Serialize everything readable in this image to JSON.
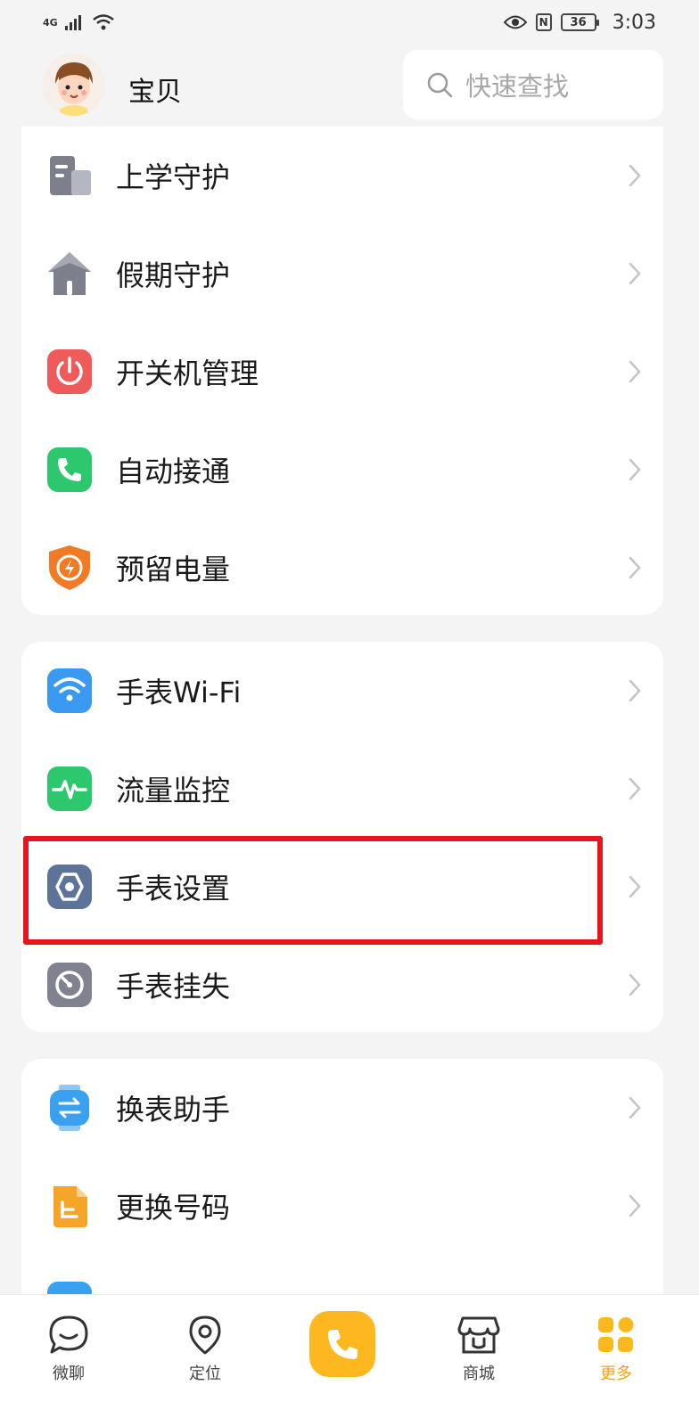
{
  "status_bar": {
    "network": "4G",
    "battery": "36",
    "time": "3:03"
  },
  "header": {
    "user_name": "宝贝",
    "search_placeholder": "快速查找"
  },
  "groups": [
    {
      "items": [
        {
          "label": "上学守护",
          "icon": "school-building-icon",
          "color": "#8a8d99"
        },
        {
          "label": "假期守护",
          "icon": "house-icon",
          "color": "#7d808c"
        },
        {
          "label": "开关机管理",
          "icon": "power-icon",
          "color": "#ef5a5a"
        },
        {
          "label": "自动接通",
          "icon": "phone-icon",
          "color": "#2dc76d"
        },
        {
          "label": "预留电量",
          "icon": "battery-shield-icon",
          "color": "#f37a24"
        }
      ]
    },
    {
      "items": [
        {
          "label": "手表Wi-Fi",
          "icon": "wifi-icon",
          "color": "#3a9af2"
        },
        {
          "label": "流量监控",
          "icon": "pulse-icon",
          "color": "#2dc76d"
        },
        {
          "label": "手表设置",
          "icon": "gear-icon",
          "color": "#5d7398"
        },
        {
          "label": "手表挂失",
          "icon": "lost-watch-icon",
          "color": "#80838f"
        }
      ]
    },
    {
      "items": [
        {
          "label": "换表助手",
          "icon": "swap-watch-icon",
          "color": "#3aa0f0"
        },
        {
          "label": "更换号码",
          "icon": "sim-card-icon",
          "color": "#f6a42a"
        }
      ]
    }
  ],
  "tabbar": {
    "tabs": [
      {
        "label": "微聊",
        "icon": "chat-bubble-icon"
      },
      {
        "label": "定位",
        "icon": "location-pin-icon"
      },
      {
        "label": "",
        "icon": "call-icon"
      },
      {
        "label": "商城",
        "icon": "store-icon"
      },
      {
        "label": "更多",
        "icon": "grid-more-icon"
      }
    ],
    "accent": "#fcb81e"
  }
}
